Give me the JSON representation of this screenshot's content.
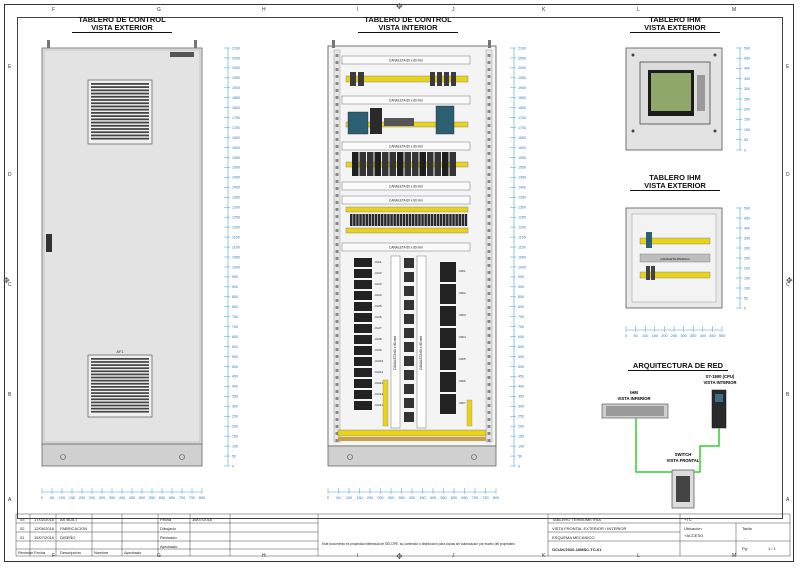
{
  "sheet": {
    "columns_top": [
      "F",
      "G",
      "H",
      "I",
      "J",
      "K",
      "L",
      "M"
    ],
    "columns_bottom": [
      "F",
      "G",
      "H",
      "I",
      "J",
      "K",
      "L",
      "M"
    ],
    "rows": [
      "E",
      "D",
      "C",
      "B",
      "A"
    ]
  },
  "views": {
    "exterior_title_1": "TABLERO DE CONTROL",
    "exterior_title_2": "VISTA EXTERIOR",
    "interior_title_1": "TABLERO DE CONTROL",
    "interior_title_2": "VISTA INTERIOR",
    "ihm_ext_title_1": "TABLERO IHM",
    "ihm_ext_title_2": "VISTA EXTERIOR",
    "ihm_int_title_1": "TABLERO IHM",
    "ihm_int_title_2": "VISTA EXTERIOR",
    "net_title": "ARQUITECTURA DE RED",
    "hmi_label_1": "IHM",
    "hmi_label_2": "VISTA INFERIOR",
    "plc_label_1": "S7-1500 (CPU)",
    "plc_label_2": "VISTA INTERIOR",
    "switch_label_1": "SWITCH",
    "switch_label_2": "VISTA FRONTAL",
    "door_tag": "AF1"
  },
  "scales": {
    "tall_ticks": [
      "2100",
      "2050",
      "2000",
      "1950",
      "1900",
      "1850",
      "1800",
      "1750",
      "1700",
      "1650",
      "1600",
      "1550",
      "1500",
      "1450",
      "1400",
      "1350",
      "1300",
      "1250",
      "1200",
      "1150",
      "1100",
      "1050",
      "1000",
      "950",
      "900",
      "850",
      "800",
      "750",
      "700",
      "650",
      "600",
      "550",
      "500",
      "450",
      "400",
      "350",
      "300",
      "250",
      "200",
      "150",
      "100",
      "50",
      "0"
    ],
    "wide_ticks": [
      "0",
      "50",
      "100",
      "150",
      "200",
      "250",
      "300",
      "350",
      "400",
      "450",
      "500",
      "550",
      "600",
      "650",
      "700",
      "750",
      "800"
    ],
    "ihm_v_ticks": [
      "500",
      "450",
      "400",
      "350",
      "300",
      "250",
      "200",
      "150",
      "100",
      "50",
      "0"
    ],
    "ihm_h_ticks": [
      "0",
      "50",
      "100",
      "150",
      "200",
      "250",
      "300",
      "350",
      "400",
      "450",
      "500"
    ]
  },
  "interior": {
    "ducts": [
      "CANALETA 60 x 60 mm",
      "CANALETA 60 x 60 mm",
      "CANALETA 60 x 60 mm",
      "CANALETA 60 x 60 mm",
      "CANALETA 60 x 60 mm",
      "CANALETA 60 x 60 mm"
    ],
    "vertical_duct_1": "CANALETA 60 x 80 mm",
    "vertical_duct_2": "CANALETA 60 x 80 mm",
    "terminals_left": [
      "-XAI1",
      "-XAI2",
      "-XAI3",
      "-XAI4",
      "-XAI5",
      "-XAI6",
      "-XAI7",
      "-XAI8",
      "-XAI9",
      "-XAI10",
      "-XAI11",
      "-XAI12",
      "-XAI13",
      "-XAI14"
    ],
    "terminals_right": [
      "-XDI1",
      "-XDI2",
      "-XDI3",
      "-XDI4",
      "-XDI5",
      "-XDI6",
      "-XDI7"
    ],
    "ihm_duct": "CANALETA 25x40mm"
  },
  "title_block": {
    "revisions": [
      {
        "rev": "03",
        "date": "17/02/2016",
        "desc": "AS BUILT"
      },
      {
        "rev": "02",
        "date": "12/06/2016",
        "desc": "FABRICACION"
      },
      {
        "rev": "01",
        "date": "15/07/2016",
        "desc": "DISEÑO"
      }
    ],
    "rev_header": "Revisión",
    "date_header": "Fecha",
    "desc_header": "Descripción",
    "name_header": "Nombre",
    "approved_header": "Aprobado",
    "role_date": "Fecha",
    "role_drawn": "Dibujado",
    "role_reviewed": "Revisado",
    "role_approved": "Aprobado",
    "sign_date": "16/07/2016",
    "notice": "Este documento es propiedad intelectual de SECOPE, su contenido o distribución para copias sin autorización por escrito del propietario",
    "project": "TABLERO TERMOMETRIA",
    "subtitle": "VISTA FRONTAL EXTERIOR / INTERIOR",
    "doc_type": "ESQUEMA MECANICO",
    "doc_number": "OC/AV/2020-16MSC-TC-01",
    "eq": "+TC",
    "loc": "Ubicación",
    "loc_val": "+ACCESO",
    "sheet_lbl": "Tarifa",
    "pg_lbl": "Pg.",
    "pg": "1 / 1",
    "dash": "-"
  }
}
